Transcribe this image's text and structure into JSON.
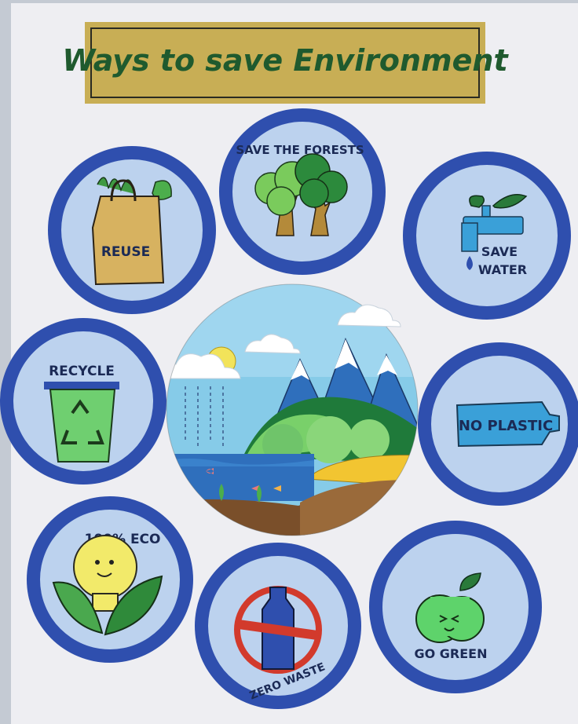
{
  "poster": {
    "title": "Ways to save Environment",
    "colors": {
      "paper": "#eeeef2",
      "ring": "#2f4fae",
      "disc": "#bcd2ee",
      "title_banner": "#c8ae55",
      "title_text": "#1f5a2e"
    },
    "badges": [
      {
        "id": "reuse",
        "label": "REUSE",
        "icon": "shopping-bag-icon"
      },
      {
        "id": "forests",
        "label": "SAVE THE FORESTS",
        "icon": "trees-icon"
      },
      {
        "id": "water",
        "label_line1": "SAVE",
        "label_line2": "WATER",
        "icon": "tap-icon"
      },
      {
        "id": "recycle",
        "label": "RECYCLE",
        "icon": "recycle-bin-icon"
      },
      {
        "id": "plastic",
        "label": "NO PLASTIC",
        "icon": "bottle-icon"
      },
      {
        "id": "eco",
        "label": "100% ECO",
        "icon": "bulb-icon"
      },
      {
        "id": "zero",
        "label": "ZERO WASTE",
        "icon": "no-bottle-icon"
      },
      {
        "id": "green",
        "label": "GO GREEN",
        "icon": "apple-icon"
      }
    ],
    "center": {
      "scene": "landscape-scene"
    }
  }
}
